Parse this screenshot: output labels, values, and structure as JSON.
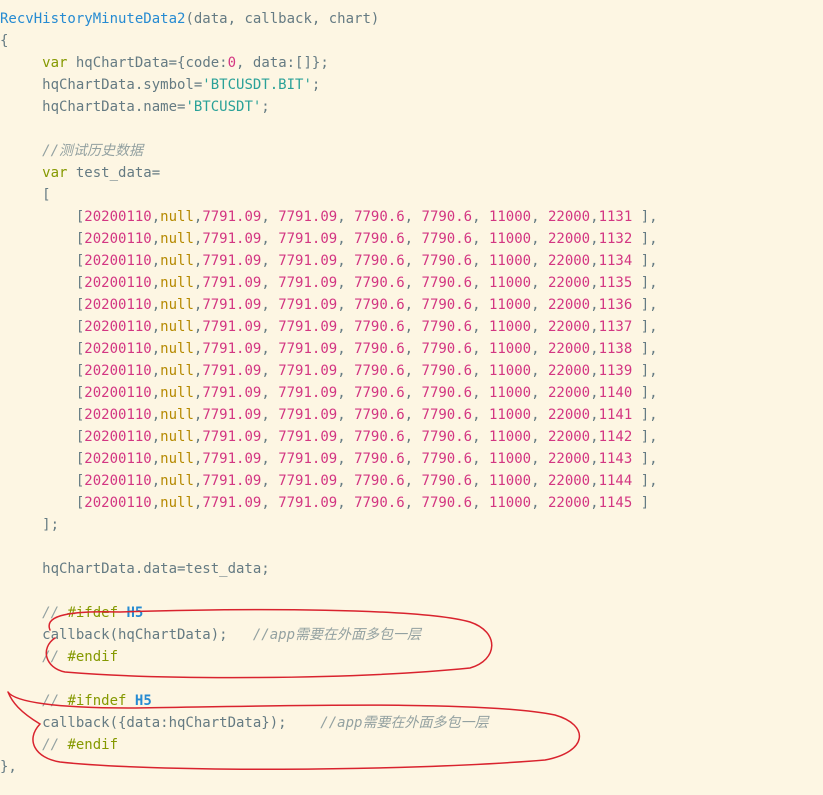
{
  "code": {
    "fn_name": "RecvHistoryMinuteData2",
    "params": "(data, callback, chart)",
    "brace_open": "{",
    "line_decl_a": "var",
    "line_decl_b": " hqChartData={code:",
    "zero": "0",
    "line_decl_c": ", data:[]};",
    "line_symbol_a": "hqChartData.symbol=",
    "str_symbol": "'BTCUSDT.BIT'",
    "semi": ";",
    "line_name_a": "hqChartData.name=",
    "str_name": "'BTCUSDT'",
    "comment_test": "//测试历史数据",
    "var2": "var",
    "test_decl": " test_data=",
    "bracket_open": "[",
    "rows": [
      {
        "date": "20200110",
        "v1": "7791.09",
        "v2": "7791.09",
        "v3": "7790.6",
        "v4": "7790.6",
        "v5": "11000",
        "v6": "22000",
        "v7": "1131"
      },
      {
        "date": "20200110",
        "v1": "7791.09",
        "v2": "7791.09",
        "v3": "7790.6",
        "v4": "7790.6",
        "v5": "11000",
        "v6": "22000",
        "v7": "1132"
      },
      {
        "date": "20200110",
        "v1": "7791.09",
        "v2": "7791.09",
        "v3": "7790.6",
        "v4": "7790.6",
        "v5": "11000",
        "v6": "22000",
        "v7": "1134"
      },
      {
        "date": "20200110",
        "v1": "7791.09",
        "v2": "7791.09",
        "v3": "7790.6",
        "v4": "7790.6",
        "v5": "11000",
        "v6": "22000",
        "v7": "1135"
      },
      {
        "date": "20200110",
        "v1": "7791.09",
        "v2": "7791.09",
        "v3": "7790.6",
        "v4": "7790.6",
        "v5": "11000",
        "v6": "22000",
        "v7": "1136"
      },
      {
        "date": "20200110",
        "v1": "7791.09",
        "v2": "7791.09",
        "v3": "7790.6",
        "v4": "7790.6",
        "v5": "11000",
        "v6": "22000",
        "v7": "1137"
      },
      {
        "date": "20200110",
        "v1": "7791.09",
        "v2": "7791.09",
        "v3": "7790.6",
        "v4": "7790.6",
        "v5": "11000",
        "v6": "22000",
        "v7": "1138"
      },
      {
        "date": "20200110",
        "v1": "7791.09",
        "v2": "7791.09",
        "v3": "7790.6",
        "v4": "7790.6",
        "v5": "11000",
        "v6": "22000",
        "v7": "1139"
      },
      {
        "date": "20200110",
        "v1": "7791.09",
        "v2": "7791.09",
        "v3": "7790.6",
        "v4": "7790.6",
        "v5": "11000",
        "v6": "22000",
        "v7": "1140"
      },
      {
        "date": "20200110",
        "v1": "7791.09",
        "v2": "7791.09",
        "v3": "7790.6",
        "v4": "7790.6",
        "v5": "11000",
        "v6": "22000",
        "v7": "1141"
      },
      {
        "date": "20200110",
        "v1": "7791.09",
        "v2": "7791.09",
        "v3": "7790.6",
        "v4": "7790.6",
        "v5": "11000",
        "v6": "22000",
        "v7": "1142"
      },
      {
        "date": "20200110",
        "v1": "7791.09",
        "v2": "7791.09",
        "v3": "7790.6",
        "v4": "7790.6",
        "v5": "11000",
        "v6": "22000",
        "v7": "1143"
      },
      {
        "date": "20200110",
        "v1": "7791.09",
        "v2": "7791.09",
        "v3": "7790.6",
        "v4": "7790.6",
        "v5": "11000",
        "v6": "22000",
        "v7": "1144"
      },
      {
        "date": "20200110",
        "v1": "7791.09",
        "v2": "7791.09",
        "v3": "7790.6",
        "v4": "7790.6",
        "v5": "11000",
        "v6": "22000",
        "v7": "1145"
      }
    ],
    "bracket_close": "];",
    "assign": "hqChartData.data=test_data;",
    "comment_ifdef": "// ",
    "pp_ifdef": "#ifdef",
    "h5": " H5",
    "callback1": "callback(hqChartData);   ",
    "comment_app1": "//app需要在外面多包一层",
    "comment_endif1": "// ",
    "pp_endif": "#endif",
    "comment_ifndef": "// ",
    "pp_ifndef": "#ifndef",
    "callback2_a": "callback({data:hqChartData});    ",
    "comment_app2": "//app需要在外面多包一层",
    "comment_endif2": "// ",
    "brace_close": "},"
  }
}
